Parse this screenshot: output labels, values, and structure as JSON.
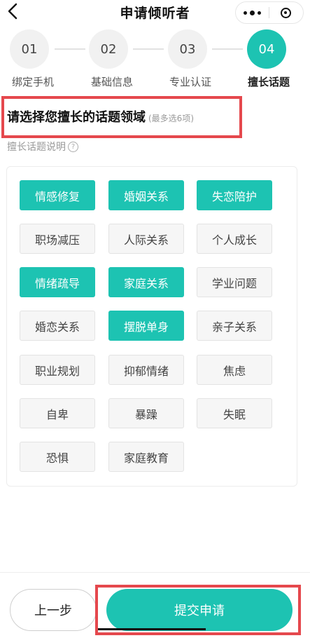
{
  "header": {
    "title": "申请倾听者",
    "back_icon": "chevron-left-icon",
    "more_icon": "more-dots-icon",
    "close_icon": "target-icon"
  },
  "steps": [
    {
      "number": "01",
      "label": "绑定手机",
      "active": false
    },
    {
      "number": "02",
      "label": "基础信息",
      "active": false
    },
    {
      "number": "03",
      "label": "专业认证",
      "active": false
    },
    {
      "number": "04",
      "label": "擅长话题",
      "active": true
    }
  ],
  "section": {
    "title": "请选择您擅长的话题领域",
    "hint": "(最多选6项)",
    "note": "擅长话题说明",
    "note_icon": "?"
  },
  "topics": [
    {
      "label": "情感修复",
      "selected": true
    },
    {
      "label": "婚姻关系",
      "selected": true
    },
    {
      "label": "失恋陪护",
      "selected": true
    },
    {
      "label": "职场减压",
      "selected": false
    },
    {
      "label": "人际关系",
      "selected": false
    },
    {
      "label": "个人成长",
      "selected": false
    },
    {
      "label": "情绪疏导",
      "selected": true
    },
    {
      "label": "家庭关系",
      "selected": true
    },
    {
      "label": "学业问题",
      "selected": false
    },
    {
      "label": "婚恋关系",
      "selected": false
    },
    {
      "label": "摆脱单身",
      "selected": true
    },
    {
      "label": "亲子关系",
      "selected": false
    },
    {
      "label": "职业规划",
      "selected": false
    },
    {
      "label": "抑郁情绪",
      "selected": false
    },
    {
      "label": "焦虑",
      "selected": false
    },
    {
      "label": "自卑",
      "selected": false
    },
    {
      "label": "暴躁",
      "selected": false
    },
    {
      "label": "失眠",
      "selected": false
    },
    {
      "label": "恐惧",
      "selected": false
    },
    {
      "label": "家庭教育",
      "selected": false
    }
  ],
  "footer": {
    "prev_label": "上一步",
    "submit_label": "提交申请"
  },
  "colors": {
    "accent": "#1dc3b2",
    "highlight": "#e5484d"
  }
}
